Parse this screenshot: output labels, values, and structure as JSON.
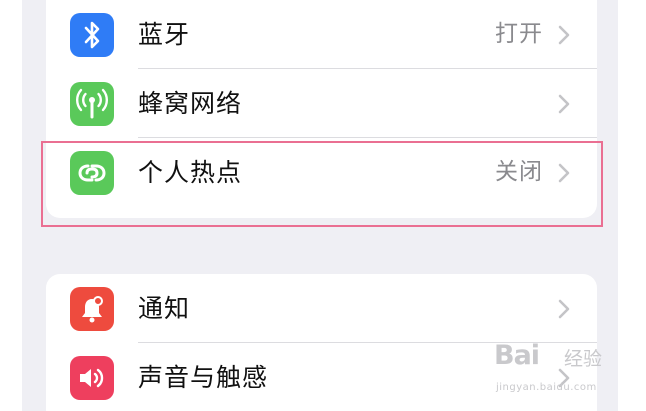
{
  "settings": {
    "group1": [
      {
        "label": "蓝牙",
        "value": "打开",
        "icon": "bluetooth-icon",
        "color": "#2f7cf6"
      },
      {
        "label": "蜂窝网络",
        "value": "",
        "icon": "cellular-antenna-icon",
        "color": "#5ac95a"
      },
      {
        "label": "个人热点",
        "value": "关闭",
        "icon": "personal-hotspot-icon",
        "color": "#5ac95a"
      }
    ],
    "group2": [
      {
        "label": "通知",
        "value": "",
        "icon": "notification-bell-icon",
        "color": "#ee4b3e"
      },
      {
        "label": "声音与触感",
        "value": "",
        "icon": "speaker-icon",
        "color": "#ee3f5e"
      }
    ]
  },
  "highlight": {
    "target": "个人热点",
    "color": "#ea6f92"
  },
  "watermark": {
    "logo": "Bai",
    "cn": "经验",
    "url": "jingyan.baidu.com"
  },
  "colors": {
    "background": "#efeff4",
    "card": "#ffffff",
    "secondary_text": "#8a8a8e"
  }
}
